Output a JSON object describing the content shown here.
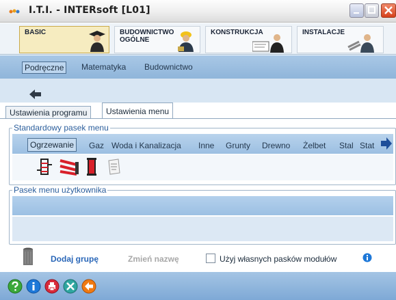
{
  "window": {
    "title": "I.T.I. - INTERsoft [L01]"
  },
  "modules": [
    {
      "label": "BASIC",
      "active": true
    },
    {
      "label": "BUDOWNICTWO\nOGÓLNE",
      "active": false
    },
    {
      "label": "KONSTRUKCJA",
      "active": false
    },
    {
      "label": "INSTALACJE",
      "active": false
    }
  ],
  "categories": [
    "Podręczne",
    "Matematyka",
    "Budownictwo"
  ],
  "tabs": [
    "Ustawienia programu",
    "Ustawienia menu"
  ],
  "standard_menu": {
    "title": "Standardowy pasek menu",
    "items": [
      "Ogrzewanie",
      "Gaz",
      "Woda i Kanalizacja",
      "Inne",
      "Grunty",
      "Drewno",
      "Żelbet",
      "Stal",
      "Stat"
    ]
  },
  "user_menu": {
    "title": "Pasek menu użytkownika"
  },
  "actions": {
    "add_group": "Dodaj grupę",
    "rename": "Zmień nazwę",
    "own_bars_label": "Użyj własnych pasków modułów",
    "own_bars_checked": false
  },
  "colors": {
    "accent": "#2a67b8",
    "frame_title": "#2b5e9c",
    "active_module": "#f6ecc0",
    "disabled_text": "#a8a8a8"
  },
  "status_icons": [
    "help-icon",
    "info-icon",
    "print-icon",
    "tools-icon",
    "exit-icon"
  ]
}
